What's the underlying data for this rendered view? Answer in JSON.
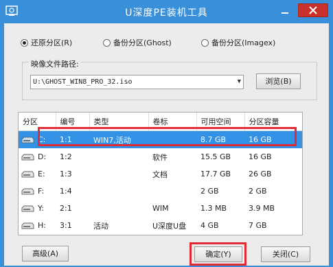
{
  "window": {
    "title": "U深度PE装机工具"
  },
  "restore_mode": {
    "options": [
      {
        "label": "还原分区(R)",
        "checked": true
      },
      {
        "label": "备份分区(Ghost)",
        "checked": false
      },
      {
        "label": "备份分区(Imagex)",
        "checked": false
      }
    ]
  },
  "image_path": {
    "label": "映像文件路径:",
    "value": "U:\\GHOST_WIN8_PRO_32.iso",
    "browse_label": "浏览(B)"
  },
  "partitions": {
    "columns": [
      "分区",
      "编号",
      "类型",
      "卷标",
      "可用空间",
      "分区容量"
    ],
    "rows": [
      {
        "drive": "C:",
        "num": "1:1",
        "type": "WIN7,活动",
        "label": "",
        "free": "8.7 GB",
        "size": "16 GB",
        "selected": true
      },
      {
        "drive": "D:",
        "num": "1:2",
        "type": "",
        "label": "软件",
        "free": "15.5 GB",
        "size": "16 GB"
      },
      {
        "drive": "E:",
        "num": "1:3",
        "type": "",
        "label": "文档",
        "free": "17.7 GB",
        "size": "26 GB"
      },
      {
        "drive": "F:",
        "num": "1:4",
        "type": "",
        "label": "",
        "free": "2 GB",
        "size": "2 GB"
      },
      {
        "drive": "Y:",
        "num": "2:1",
        "type": "",
        "label": "WIM",
        "free": "1.3 MB",
        "size": "3.9 MB"
      },
      {
        "drive": "H:",
        "num": "3:1",
        "type": "活动",
        "label": "U深度U盘",
        "free": "4 GB",
        "size": "7 GB"
      }
    ]
  },
  "footer": {
    "advanced_label": "高级(A)",
    "ok_label": "确定(Y)",
    "close_label": "关闭(C)"
  },
  "colors": {
    "titlebar": "#3a8fd9",
    "selection": "#3392e6",
    "highlight": "#e02a34"
  }
}
